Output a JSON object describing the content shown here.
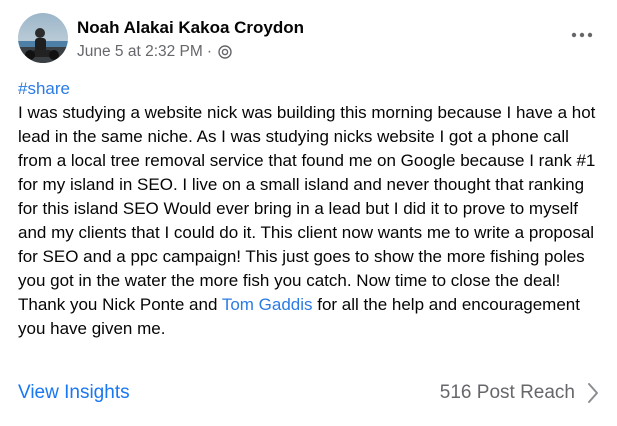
{
  "post": {
    "author_name": "Noah Alakai Kakoa Croydon",
    "timestamp": "June 5 at 2:32 PM",
    "separator": "·",
    "privacy_icon": "globe-icon",
    "more_icon": "more-horizontal-icon",
    "hashtag": "#share",
    "body_before_mention": "I was studying a website nick was building this morning because I have a hot lead in the same niche. As I was studying nicks website I got a phone call from a local tree removal service that found me on Google because I rank #1 for my island in SEO. I live on a small island and never thought that ranking for this island SEO Would ever bring in a lead but I did it to prove to myself and my clients that I could do it. This client now wants me to write a proposal for SEO and a ppc campaign! This just goes to show the more fishing poles you got in the water the more fish you catch. Now time to close the deal! Thank you Nick Ponte and ",
    "mention": "Tom Gaddis",
    "body_after_mention": " for all the help and encouragement you have given me."
  },
  "footer": {
    "insights_label": "View Insights",
    "reach_label": "516 Post Reach",
    "reach_icon": "chevron-right-icon"
  },
  "colors": {
    "link": "#1877f2",
    "secondary_text": "#65676b",
    "primary_text": "#050505"
  }
}
